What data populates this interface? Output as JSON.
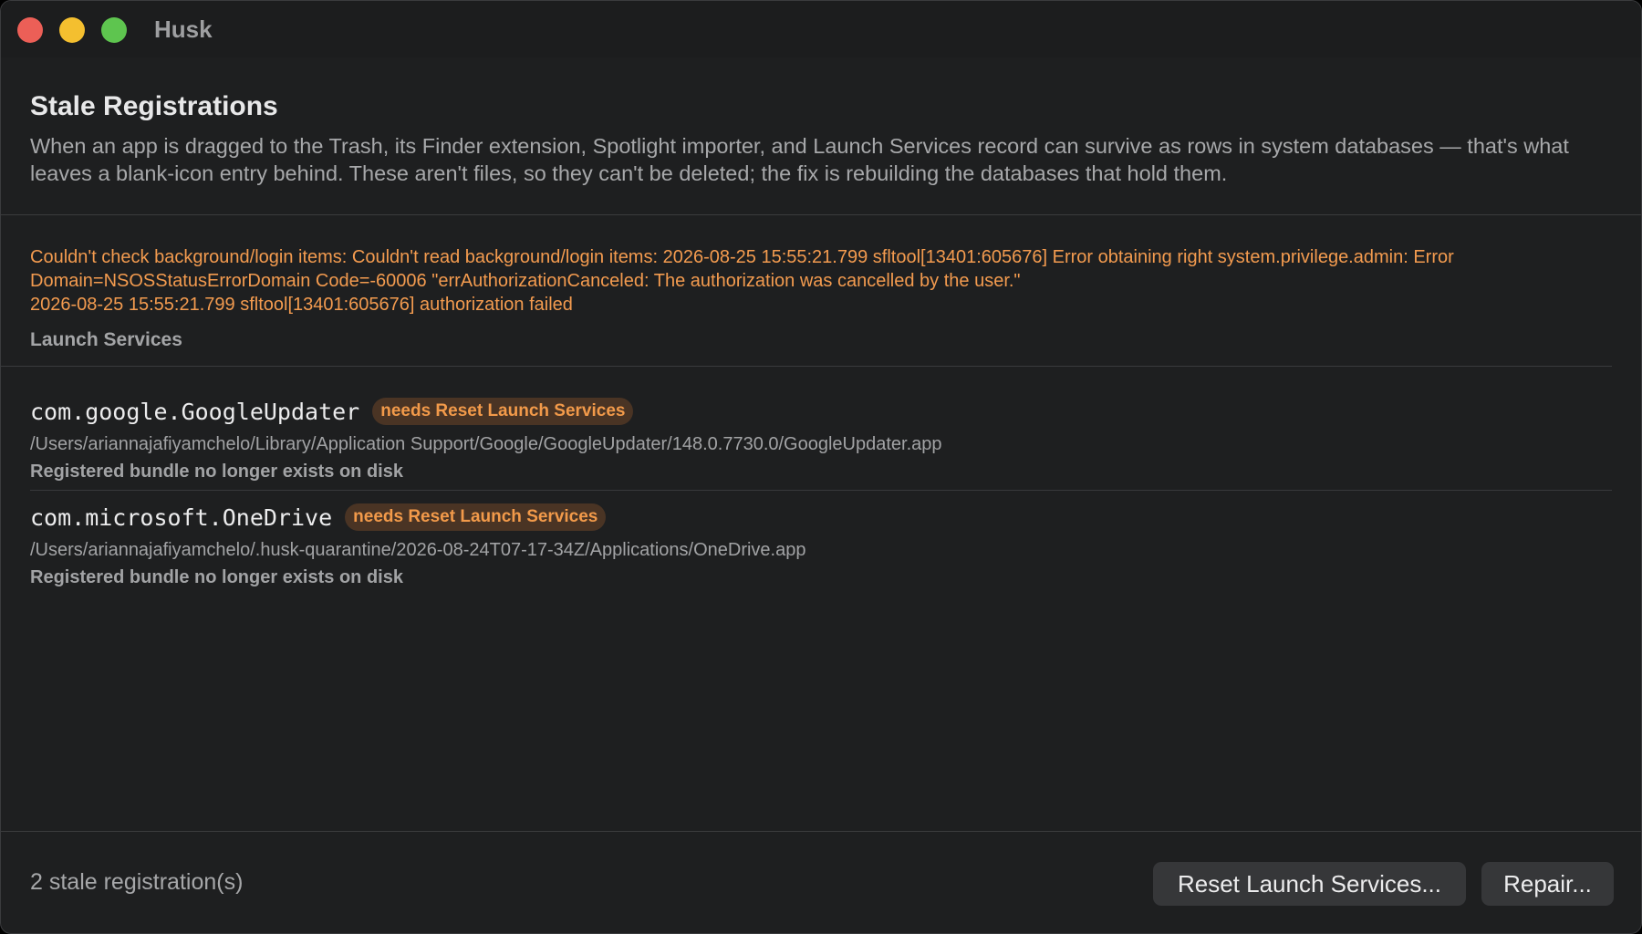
{
  "window": {
    "title": "Husk",
    "controls": [
      "close",
      "minimize",
      "maximize"
    ]
  },
  "header": {
    "title": "Stale Registrations",
    "description": "When an app is dragged to the Trash, its Finder extension, Spotlight importer, and Launch Services record can survive as rows in system databases — that's what leaves a blank-icon entry behind. These aren't files, so they can't be deleted; the fix is rebuilding the databases that hold them."
  },
  "error": {
    "text": "Couldn't check background/login items: Couldn't read background/login items: 2026-08-25 15:55:21.799 sfltool[13401:605676] Error obtaining right system.privilege.admin: Error Domain=NSOSStatusErrorDomain Code=-60006 \"errAuthorizationCanceled: The authorization was cancelled by the user.\"\n2026-08-25 15:55:21.799 sfltool[13401:605676] authorization failed",
    "color": "#f39b4f"
  },
  "section": {
    "label": "Launch Services"
  },
  "registrations": [
    {
      "bundle_id": "com.google.GoogleUpdater",
      "badge": "needs Reset Launch Services",
      "path": "/Users/ariannajafiyamchelo/Library/Application Support/Google/GoogleUpdater/148.0.7730.0/GoogleUpdater.app",
      "status": "Registered bundle no longer exists on disk"
    },
    {
      "bundle_id": "com.microsoft.OneDrive",
      "badge": "needs Reset Launch Services",
      "path": "/Users/ariannajafiyamchelo/.husk-quarantine/2026-08-24T07-17-34Z/Applications/OneDrive.app",
      "status": "Registered bundle no longer exists on disk"
    }
  ],
  "footer": {
    "count_label": "2 stale registration(s)",
    "reset_button": "Reset Launch Services...",
    "repair_button": "Repair..."
  }
}
